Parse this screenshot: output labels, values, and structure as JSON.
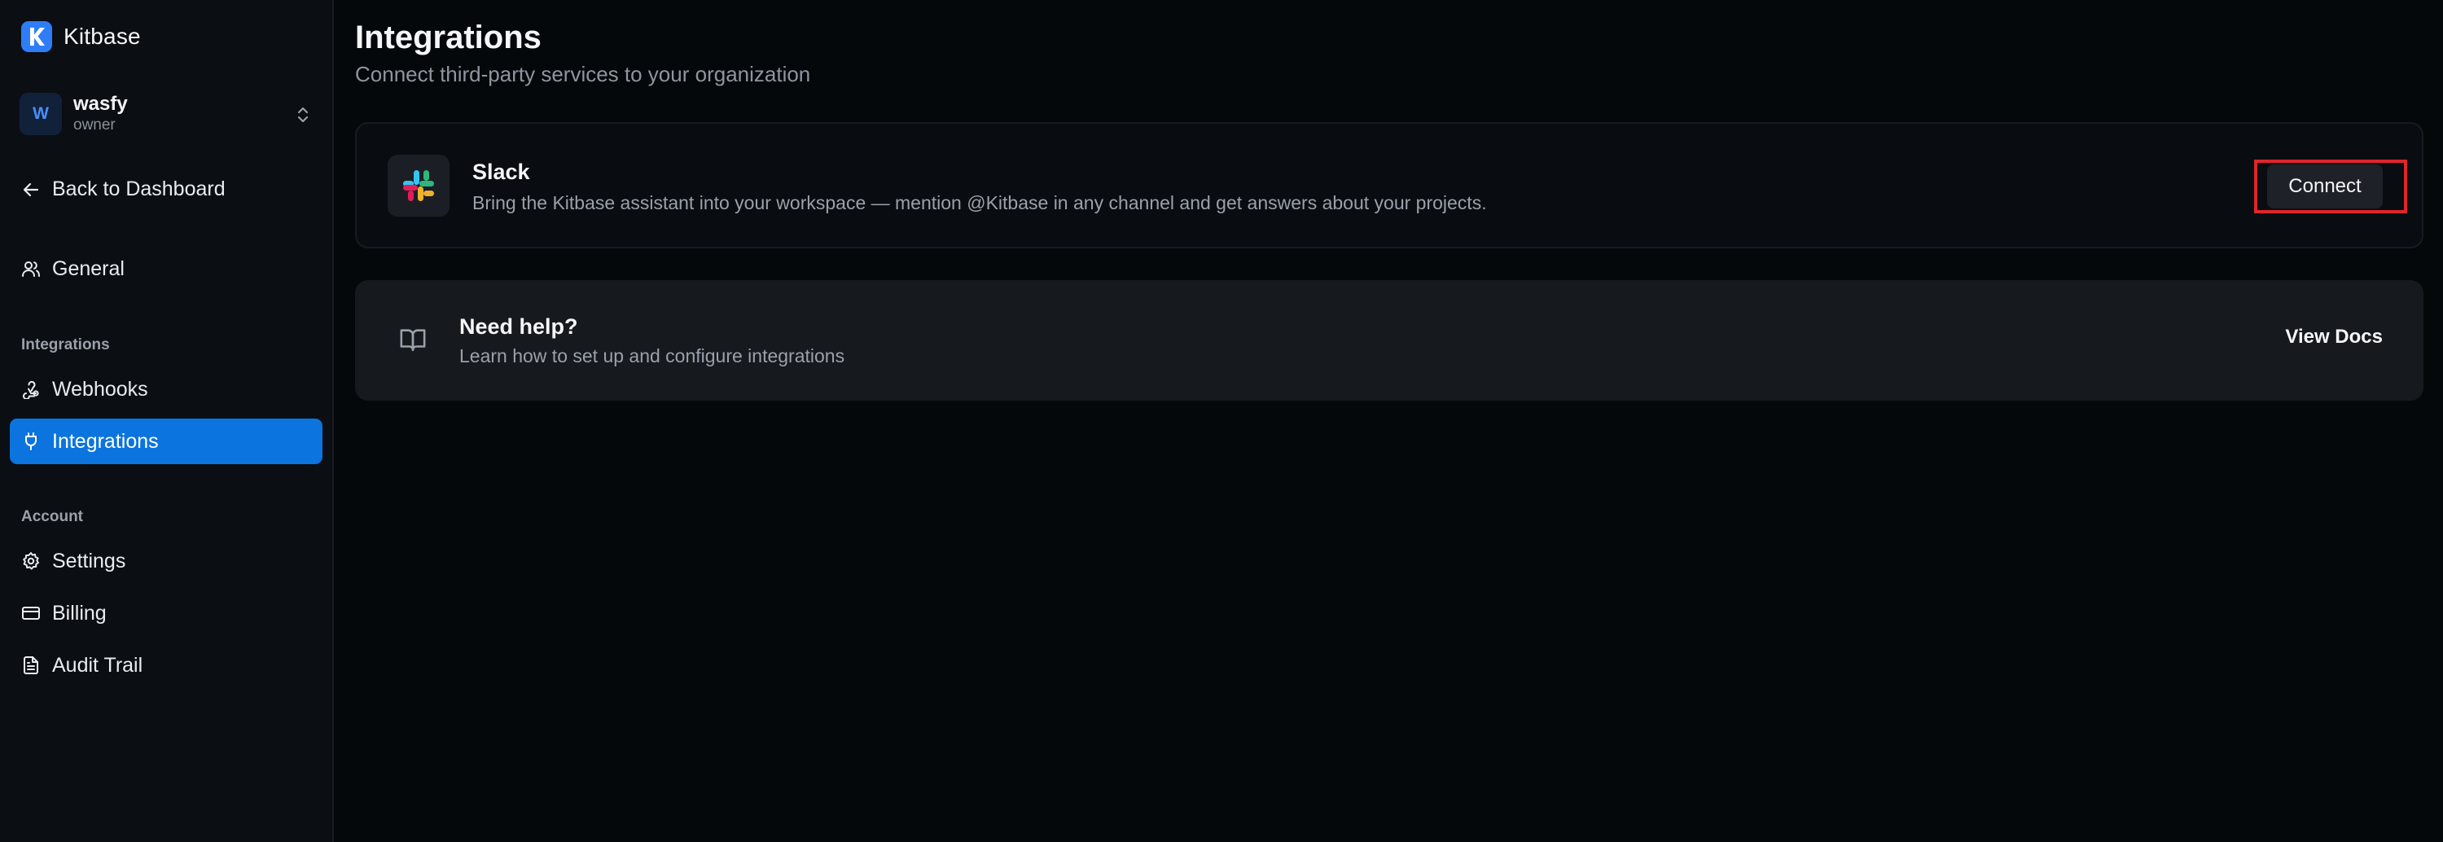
{
  "brand": {
    "name": "Kitbase",
    "logo_icon": "kitbase-logo-icon",
    "logo_color": "#2f7df6"
  },
  "org": {
    "initial": "W",
    "name": "wasfy",
    "role": "owner",
    "switch_icon": "chevron-up-down-icon"
  },
  "sidebar": {
    "back_label": "Back to Dashboard",
    "general_label": "General",
    "section_integrations": "Integrations",
    "section_account": "Account",
    "items": [
      {
        "label": "Webhooks",
        "icon": "webhook-icon",
        "active": false
      },
      {
        "label": "Integrations",
        "icon": "plug-icon",
        "active": true
      },
      {
        "label": "Settings",
        "icon": "gear-icon",
        "active": false
      },
      {
        "label": "Billing",
        "icon": "credit-card-icon",
        "active": false
      },
      {
        "label": "Audit Trail",
        "icon": "document-icon",
        "active": false
      }
    ],
    "active_color": "#0b74de"
  },
  "main": {
    "title": "Integrations",
    "subtitle": "Connect third-party services to your organization",
    "slack": {
      "name": "Slack",
      "description": "Bring the Kitbase assistant into your workspace — mention @Kitbase in any channel and get answers about your projects.",
      "button_label": "Connect",
      "icon": "slack-icon"
    },
    "help": {
      "title": "Need help?",
      "description": "Learn how to set up and configure integrations",
      "link_label": "View Docs",
      "icon": "book-open-icon"
    },
    "highlight_color": "#e0252b"
  }
}
